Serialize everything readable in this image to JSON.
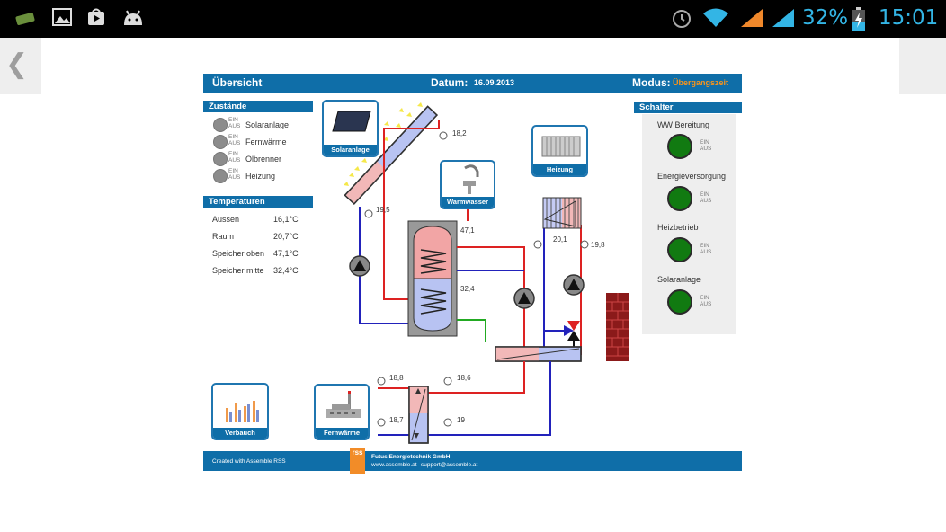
{
  "status_bar": {
    "battery_percent": "32%",
    "time": "15:01",
    "icons": [
      "sim-card-icon",
      "gallery-icon",
      "play-store-icon",
      "android-icon",
      "alarm-icon",
      "wifi-icon",
      "signal-orange-icon",
      "signal-blue-icon",
      "battery-charging-icon"
    ]
  },
  "nav": {
    "back_glyph": "❮"
  },
  "header": {
    "title": "Übersicht",
    "date_label": "Datum:",
    "date_value": "16.09.2013",
    "mode_label": "Modus:",
    "mode_value": "Übergangszeit",
    "mode_color": "#f7941d"
  },
  "zustaende": {
    "title": "Zustände",
    "ein": "EIN",
    "aus": "AUS",
    "items": [
      "Solaranlage",
      "Fernwärme",
      "Ölbrenner",
      "Heizung"
    ]
  },
  "temperaturen": {
    "title": "Temperaturen",
    "rows": [
      {
        "label": "Aussen",
        "value": "16,1°C"
      },
      {
        "label": "Raum",
        "value": "20,7°C"
      },
      {
        "label": "Speicher oben",
        "value": "47,1°C"
      },
      {
        "label": "Speicher mitte",
        "value": "32,4°C"
      }
    ]
  },
  "schalter": {
    "title": "Schalter",
    "ein": "EIN",
    "aus": "AUS",
    "items": [
      "WW Bereitung",
      "Energieversorgung",
      "Heizbetrieb",
      "Solaranlage"
    ],
    "color": "#117a11"
  },
  "tiles": {
    "solaranlage": "Solaranlage",
    "warmwasser": "Warmwasser",
    "heizung": "Heizung",
    "verbrauch": "Verbauch",
    "fernwaerme": "Fernwärme"
  },
  "diagram": {
    "sensor_solar_top": "18,2",
    "sensor_solar_bottom": "19,5",
    "storage_top": "47,1",
    "storage_mid": "32,4",
    "heating_flow": "20,1",
    "heating_return": "19,8",
    "hx_in_top": "18,8",
    "hx_out_top": "18,6",
    "hx_in_bottom": "18,7",
    "hx_out_bottom": "19"
  },
  "footer": {
    "created": "Created with Assemble RSS",
    "company": "Futus Energietechnik GmbH",
    "website": "www.assemble.at",
    "email": "support@assemble.at",
    "logo": "rss"
  }
}
